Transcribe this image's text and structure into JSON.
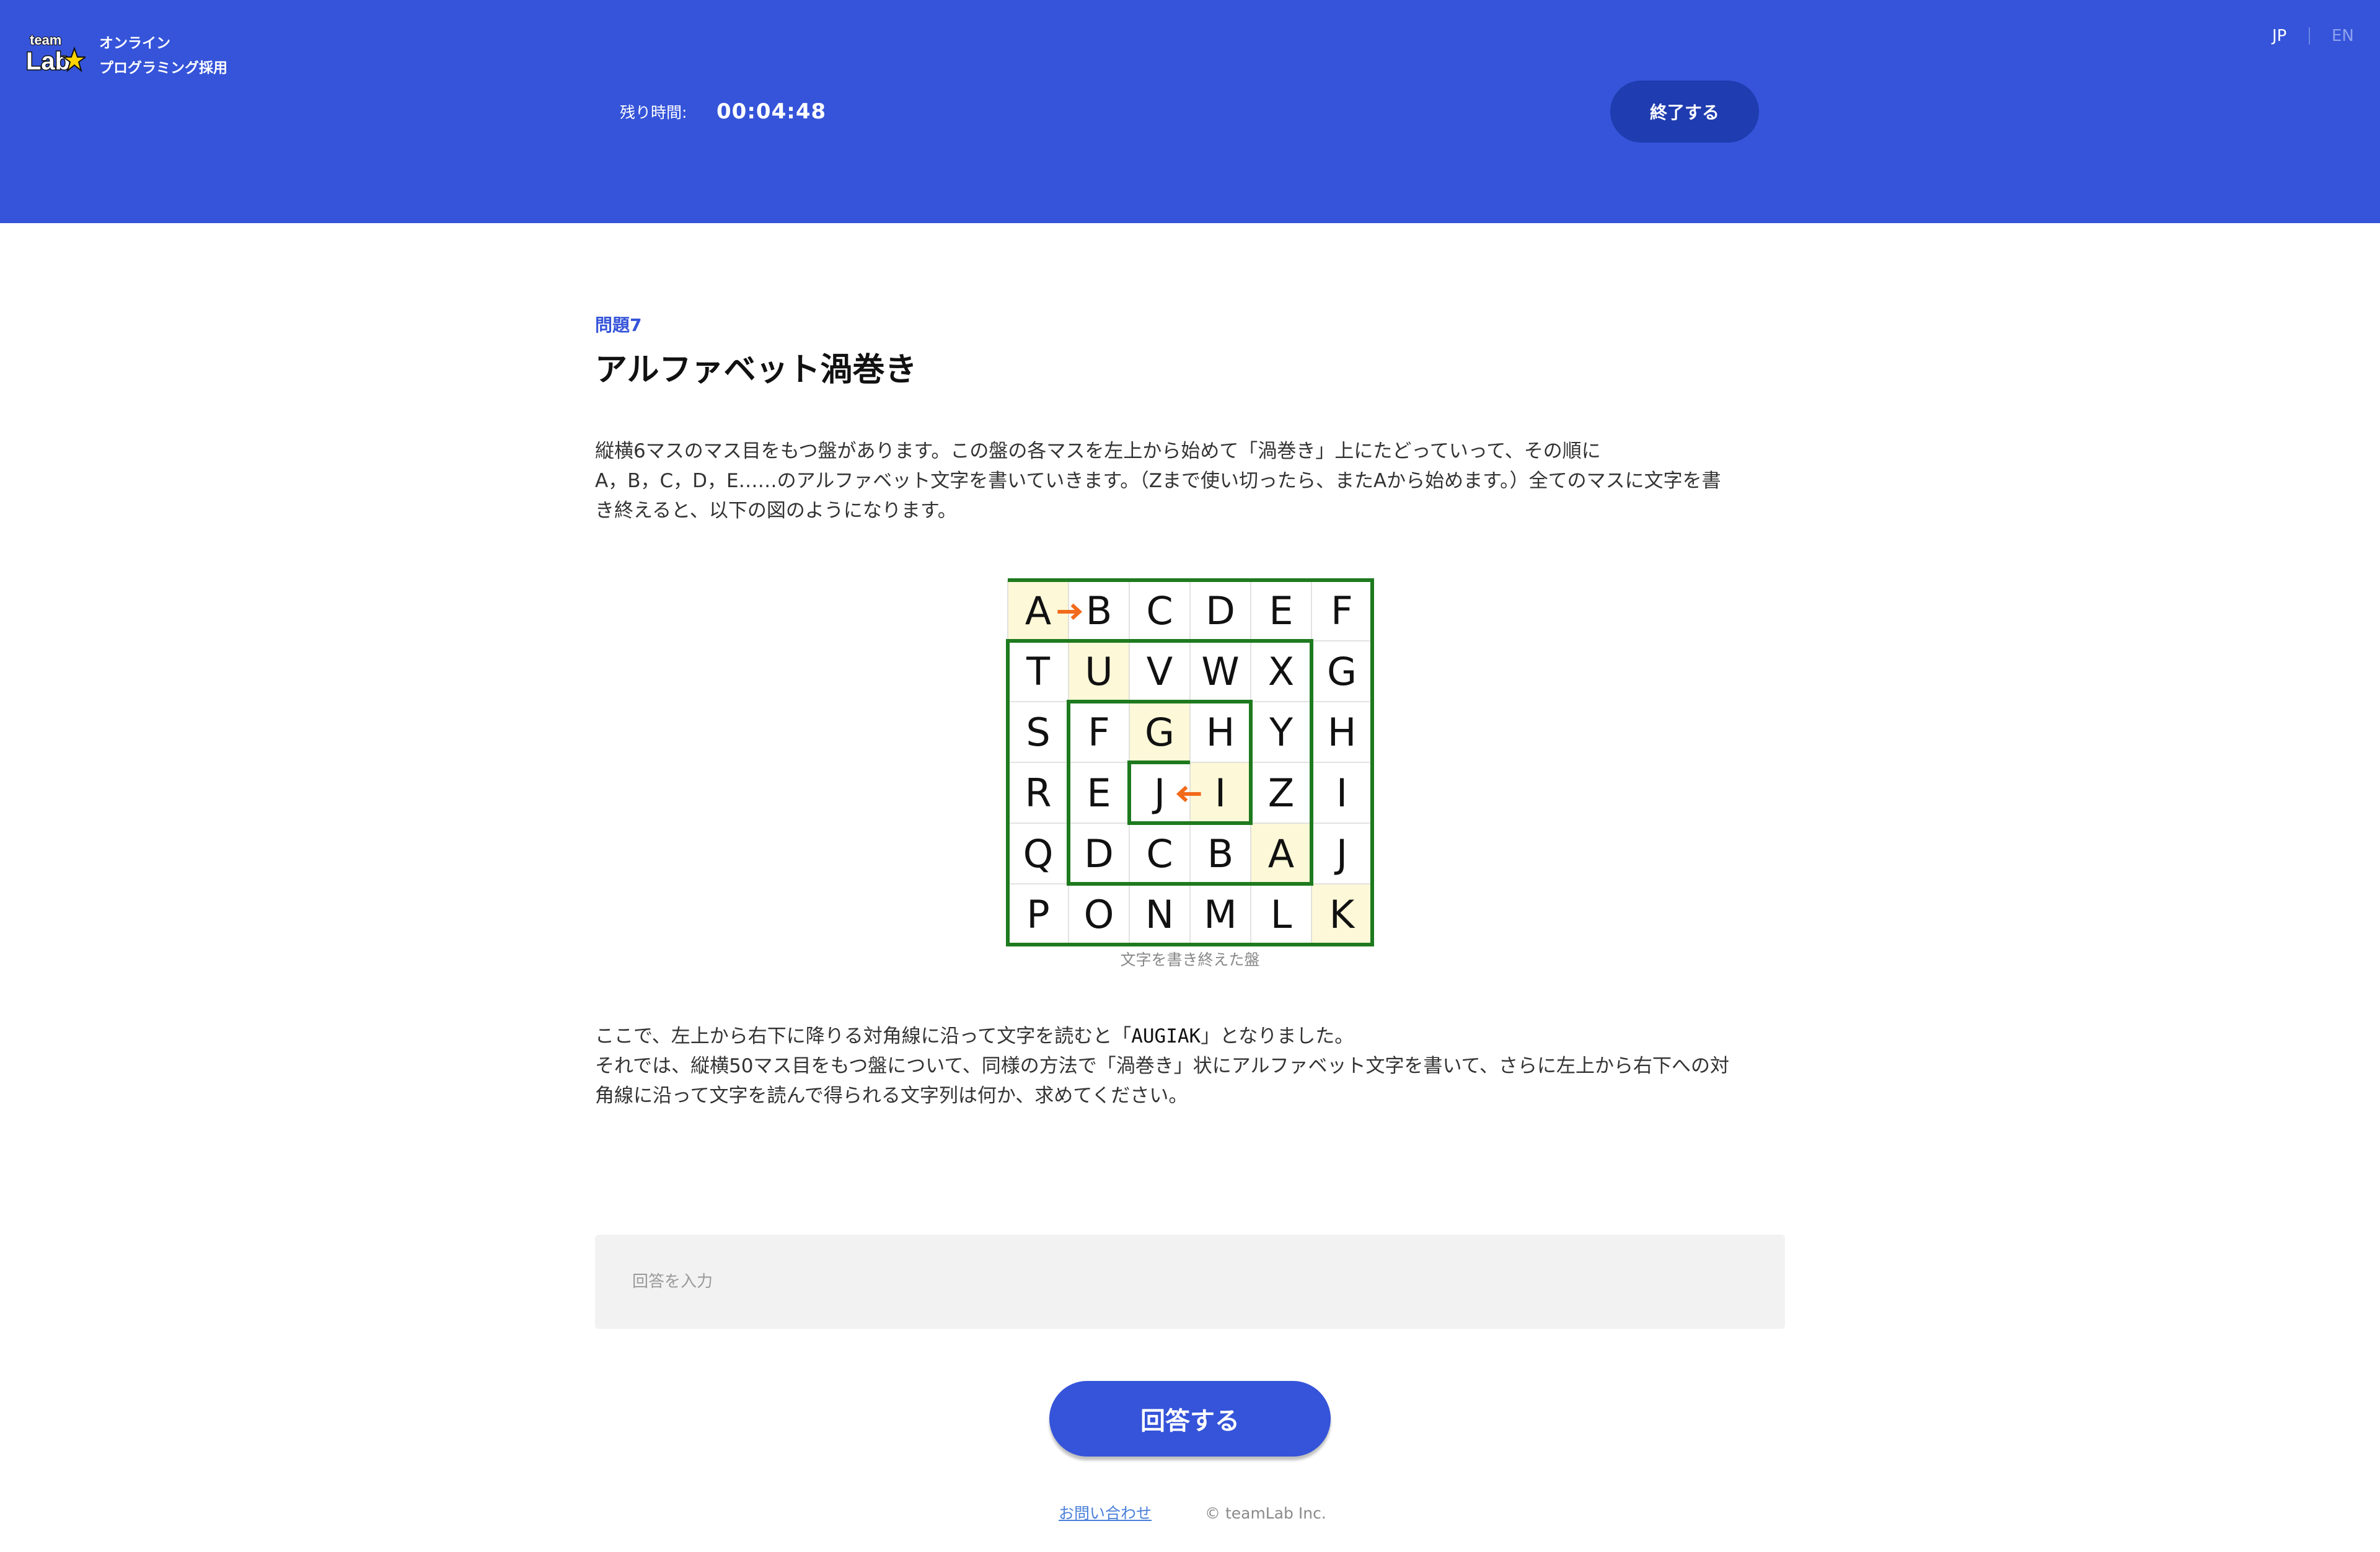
{
  "header": {
    "brand_line1": "オンライン",
    "brand_line2": "プログラミング採用",
    "logo_text": "teamLab",
    "timer_label": "残り時間:",
    "timer_value": "00:04:48",
    "end_button": "終了する",
    "lang_jp": "JP",
    "lang_en": "EN"
  },
  "problem": {
    "number": "問題7",
    "title": "アルファベット渦巻き",
    "para1_line1": "縦横6マスのマス目をもつ盤があります。この盤の各マスを左上から始めて「渦巻き」上にたどっていって、その順に",
    "para1_line2": "A，B，C，D，E……のアルファベット文字を書いていきます。（Zまで使い切ったら、またAから始めます。）全てのマスに文字を書",
    "para1_line3": "き終えると、以下の図のようになります。",
    "figure_caption": "文字を書き終えた盤",
    "para2_line1_pre": "ここで、左上から右下に降りる対角線に沿って文字を読むと「",
    "para2_line1_code": "AUGIAK",
    "para2_line1_post": "」となりました。",
    "para2_line2": "それでは、縦横50マス目をもつ盤について、同様の方法で「渦巻き」状にアルファベット文字を書いて、さらに左上から右下への対",
    "para2_line3": "角線に沿って文字を読んで得られる文字列は何か、求めてください。"
  },
  "grid": {
    "rows": [
      [
        "A",
        "B",
        "C",
        "D",
        "E",
        "F"
      ],
      [
        "T",
        "U",
        "V",
        "W",
        "X",
        "G"
      ],
      [
        "S",
        "F",
        "G",
        "H",
        "Y",
        "H"
      ],
      [
        "R",
        "E",
        "J",
        "I",
        "Z",
        "I"
      ],
      [
        "Q",
        "D",
        "C",
        "B",
        "A",
        "J"
      ],
      [
        "P",
        "O",
        "N",
        "M",
        "L",
        "K"
      ]
    ],
    "highlight_color": "#fdf8d8",
    "line_color": "#1e7a1e",
    "arrow_color": "#f26a1b"
  },
  "answer": {
    "placeholder": "回答を入力",
    "submit": "回答する"
  },
  "footer": {
    "contact": "お問い合わせ",
    "copyright": "© teamLab Inc."
  }
}
